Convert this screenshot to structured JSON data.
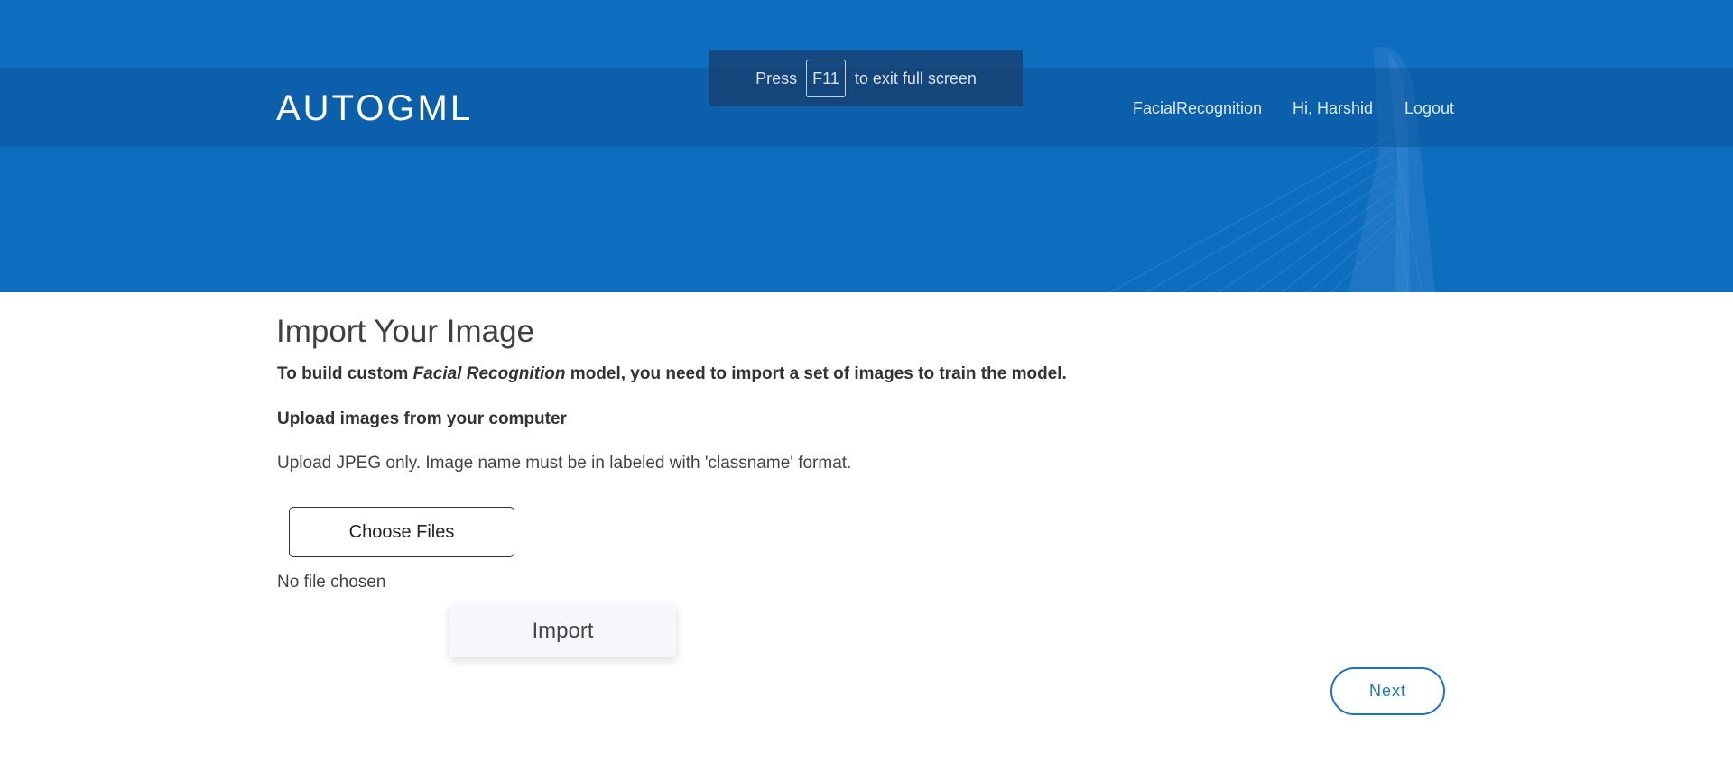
{
  "header": {
    "brand": "AUTOGML",
    "nav": {
      "project": "FacialRecognition",
      "greeting": "Hi, Harshid",
      "logout": "Logout"
    },
    "colors": {
      "hero_background": "#0d6ec0",
      "nav_band": "#0a5aa3",
      "brand_text": "#ffffff"
    }
  },
  "fullscreen_notice": {
    "prefix": "Press",
    "key": "F11",
    "suffix": "to exit full screen"
  },
  "main": {
    "title": "Import Your Image",
    "description": {
      "before": "To build custom ",
      "emphasis": "Facial Recognition",
      "after": " model, you need to import a set of images to train the model."
    },
    "upload_heading": "Upload images from your computer",
    "upload_note": "Upload JPEG only. Image name must be in labeled with 'classname' format.",
    "file_input": {
      "button_label": "Choose Files",
      "status": "No file chosen"
    },
    "import_label": "Import",
    "next_label": "Next",
    "accent_color": "#1b73c8"
  }
}
